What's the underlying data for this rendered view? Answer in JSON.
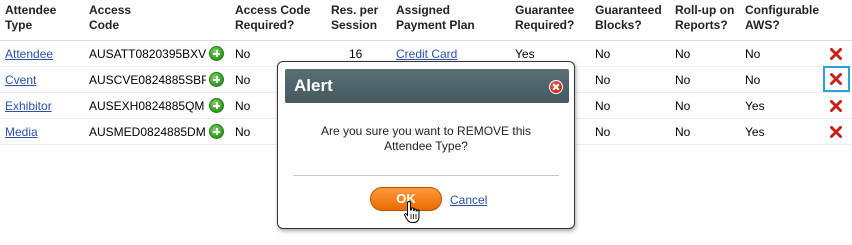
{
  "table": {
    "headers": [
      {
        "line1": "Attendee",
        "line2": "Type"
      },
      {
        "line1": "Access",
        "line2": "Code"
      },
      {
        "line1": "Access Code",
        "line2": "Required?"
      },
      {
        "line1": "Res. per",
        "line2": "Session"
      },
      {
        "line1": "Assigned",
        "line2": "Payment Plan"
      },
      {
        "line1": "Guarantee",
        "line2": "Required?"
      },
      {
        "line1": "Guaranteed",
        "line2": "Blocks?"
      },
      {
        "line1": "Roll-up on",
        "line2": "Reports?"
      },
      {
        "line1": "Configurable",
        "line2": "AWS?"
      }
    ],
    "rows": [
      {
        "type": "Attendee",
        "code": "AUSATT0820395BXV",
        "code_required": "No",
        "res_per_session": "16",
        "payment_plan": "Credit Card",
        "guarantee_required": "Yes",
        "guaranteed_blocks": "No",
        "rollup": "No",
        "aws": "No"
      },
      {
        "type": "Cvent",
        "code": "AUSCVE0824885SBF",
        "code_required": "No",
        "res_per_session": "",
        "payment_plan": "",
        "guarantee_required": "",
        "guaranteed_blocks": "No",
        "rollup": "No",
        "aws": "No"
      },
      {
        "type": "Exhibitor",
        "code": "AUSEXH0824885QM",
        "code_required": "No",
        "res_per_session": "",
        "payment_plan": "",
        "guarantee_required": "",
        "guaranteed_blocks": "No",
        "rollup": "No",
        "aws": "Yes"
      },
      {
        "type": "Media",
        "code": "AUSMED0824885DM",
        "code_required": "No",
        "res_per_session": "",
        "payment_plan": "",
        "guarantee_required": "",
        "guaranteed_blocks": "No",
        "rollup": "No",
        "aws": "Yes"
      }
    ]
  },
  "dialog": {
    "title": "Alert",
    "message": "Are you sure you want to REMOVE this Attendee Type?",
    "ok_label": "OK",
    "cancel_label": "Cancel"
  },
  "colors": {
    "link": "#2a52a8",
    "add_icon": "#2f9a1e",
    "delete_icon": "#c8201a",
    "focus_ring": "#2aa3d8",
    "dialog_header": "#4f6369",
    "ok_button": "#f07d12"
  },
  "icons": {
    "add": "plus-circle-icon",
    "delete": "red-x-icon",
    "close": "close-circle-icon",
    "cursor": "hand-pointer-icon"
  }
}
